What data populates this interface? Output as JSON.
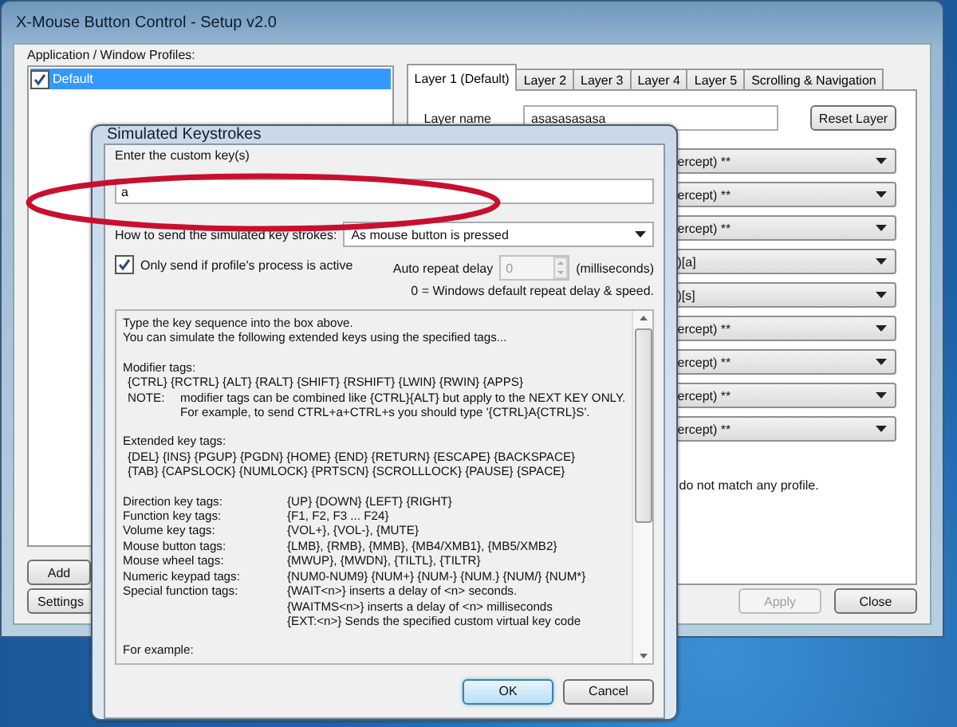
{
  "main_window": {
    "title": "X-Mouse Button Control - Setup v2.0",
    "profiles_label": "Application / Window Profiles:",
    "profiles": [
      {
        "label": "Default",
        "checked": true,
        "selected": true
      }
    ],
    "tabs": [
      {
        "label": "Layer 1 (Default)",
        "selected": true
      },
      {
        "label": "Layer 2",
        "selected": false
      },
      {
        "label": "Layer 3",
        "selected": false
      },
      {
        "label": "Layer 4",
        "selected": false
      },
      {
        "label": "Layer 5",
        "selected": false
      },
      {
        "label": "Scrolling & Navigation",
        "selected": false
      }
    ],
    "layer_name_label": "Layer name",
    "layer_name": "asasasasasa",
    "reset_button": "Reset Layer",
    "actions": [
      "ercept) **",
      "ercept) **",
      "ercept) **",
      ")[a]",
      ")[s]",
      "ercept) **",
      "ercept) **",
      "ercept) **",
      "ercept) **"
    ],
    "profile_note": "do not match any profile.",
    "left_buttons": [
      "Add",
      "Settings"
    ],
    "right_buttons": [
      {
        "label": "Apply",
        "disabled": true
      },
      {
        "label": "Close",
        "disabled": false
      }
    ]
  },
  "dialog": {
    "title": "Simulated Keystrokes",
    "key_label": "Enter the custom key(s)",
    "key_value": "a",
    "send_label": "How to send the simulated key strokes:",
    "send_mode": "As mouse button is pressed",
    "only_active": {
      "label": "Only send if profile's process is active",
      "checked": true
    },
    "repeat_label": "Auto repeat delay",
    "repeat_value": "0",
    "repeat_disabled": true,
    "repeat_unit": "(milliseconds)",
    "repeat_note": "0 = Windows default repeat delay & speed.",
    "help": [
      {
        "kind": "lines",
        "lines": [
          "Type the key sequence into the box above.",
          "You can simulate the following extended keys using the specified tags..."
        ]
      },
      {
        "kind": "section",
        "title": "Modifier tags:",
        "lines": [
          "{CTRL} {RCTRL} {ALT} {RALT} {SHIFT} {RSHIFT} {LWIN} {RWIN} {APPS}"
        ],
        "note": {
          "label": "NOTE:",
          "lines": [
            "modifier tags can be combined like {CTRL}{ALT} but apply to the NEXT KEY ONLY.",
            "For example, to send CTRL+a+CTRL+s you should type '{CTRL}A{CTRL}S'."
          ]
        }
      },
      {
        "kind": "section",
        "title": "Extended key tags:",
        "lines": [
          "{DEL} {INS} {PGUP} {PGDN} {HOME} {END} {RETURN} {ESCAPE} {BACKSPACE}",
          "{TAB} {CAPSLOCK} {NUMLOCK} {PRTSCN} {SCROLLLOCK} {PAUSE} {SPACE}"
        ]
      },
      {
        "kind": "table",
        "rows": [
          {
            "label": "Direction key tags:",
            "values": [
              "{UP} {DOWN} {LEFT} {RIGHT}"
            ]
          },
          {
            "label": "Function key tags:",
            "values": [
              "{F1, F2, F3 ... F24}"
            ]
          },
          {
            "label": "Volume key tags:",
            "values": [
              "{VOL+}, {VOL-}, {MUTE}"
            ]
          },
          {
            "label": "Mouse button tags:",
            "values": [
              "{LMB}, {RMB}, {MMB}, {MB4/XMB1}, {MB5/XMB2}"
            ]
          },
          {
            "label": "Mouse wheel tags:",
            "values": [
              "{MWUP}, {MWDN}, {TILTL}, {TILTR}"
            ]
          },
          {
            "label": "Numeric keypad tags:",
            "values": [
              "{NUM0-NUM9} {NUM+} {NUM-} {NUM.} {NUM/} {NUM*}"
            ]
          },
          {
            "label": "Special function tags:",
            "values": [
              "{WAIT<n>} inserts a delay of <n> seconds.",
              "{WAITMS<n>} inserts a delay of <n> milliseconds",
              "{EXT:<n>} Sends the specified custom virtual key code"
            ]
          }
        ]
      },
      {
        "kind": "lines",
        "lines": [
          "For example:"
        ]
      }
    ],
    "buttons": [
      {
        "label": "OK",
        "default": true
      },
      {
        "label": "Cancel",
        "default": false
      }
    ]
  }
}
